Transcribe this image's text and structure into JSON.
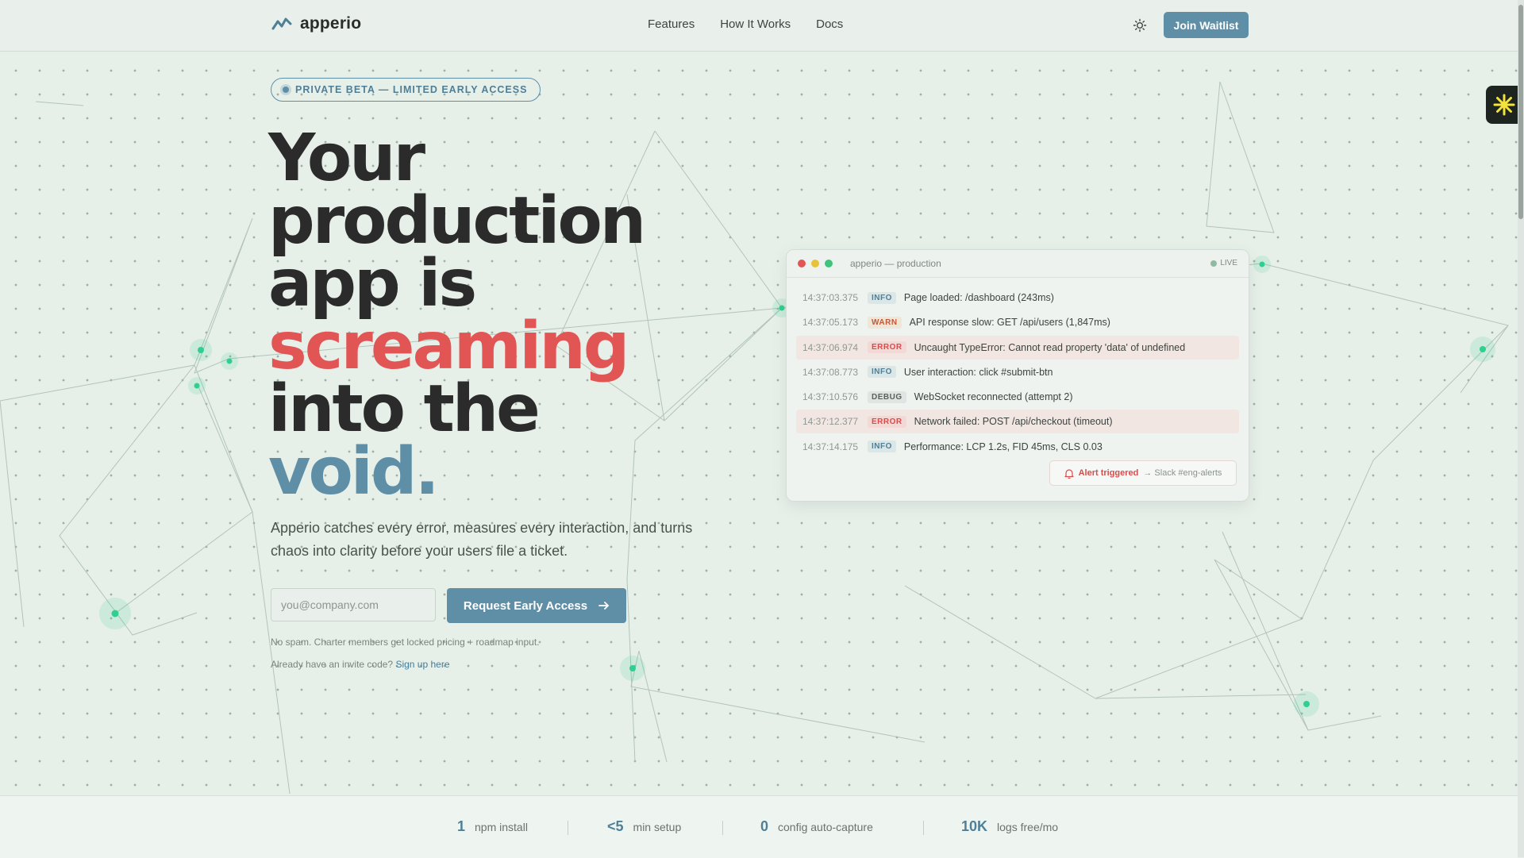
{
  "nav": {
    "logo_text": "apperio",
    "links": [
      "Features",
      "How It Works",
      "Docs"
    ],
    "join_label": "Join Waitlist"
  },
  "hero": {
    "badge": "PRIVATE BETA — LIMITED EARLY ACCESS",
    "headline": {
      "line1": "Your",
      "line2": "production",
      "line3": "app is",
      "line4": "screaming",
      "line5": "into the",
      "line6": "void."
    },
    "subtitle_line1": "Apperio catches every error, measures every interaction, and turns",
    "subtitle_line2": "chaos into clarity before your users file a ticket.",
    "email_placeholder": "you@company.com",
    "cta_label": "Request Early Access",
    "note1": "No spam. Charter members get locked pricing + roadmap input.",
    "note2_prefix": "Already have an invite code?",
    "note2_link": "Sign up here"
  },
  "terminal": {
    "title": "apperio — production",
    "live": "LIVE",
    "logs": [
      {
        "time": "14:37:03.375",
        "level": "INFO",
        "message": "Page loaded: /dashboard (243ms)"
      },
      {
        "time": "14:37:05.173",
        "level": "WARN",
        "message": "API response slow: GET /api/users (1,847ms)"
      },
      {
        "time": "14:37:06.974",
        "level": "ERROR",
        "message": "Uncaught TypeError: Cannot read property 'data' of undefined"
      },
      {
        "time": "14:37:08.773",
        "level": "INFO",
        "message": "User interaction: click #submit-btn"
      },
      {
        "time": "14:37:10.576",
        "level": "DEBUG",
        "message": "WebSocket reconnected (attempt 2)"
      },
      {
        "time": "14:37:12.377",
        "level": "ERROR",
        "message": "Network failed: POST /api/checkout (timeout)"
      },
      {
        "time": "14:37:14.175",
        "level": "INFO",
        "message": "Performance: LCP 1.2s, FID 45ms, CLS 0.03"
      }
    ],
    "alert_label": "Alert triggered",
    "alert_target": "→ Slack #eng-alerts"
  },
  "stats": [
    {
      "num": "1",
      "label": "npm install"
    },
    {
      "num": "<5",
      "label": "min setup"
    },
    {
      "num": "0",
      "label": "config auto-capture"
    },
    {
      "num": "10K",
      "label": "logs free/mo"
    }
  ],
  "colors": {
    "accent": "#5f8fa7",
    "danger": "#e25555",
    "background": "#e7efe9",
    "text": "#2b2b2b"
  },
  "icons": [
    "logo-zigzag-icon",
    "sun-icon",
    "arrow-right-icon",
    "bell-icon",
    "asterisk-icon"
  ]
}
